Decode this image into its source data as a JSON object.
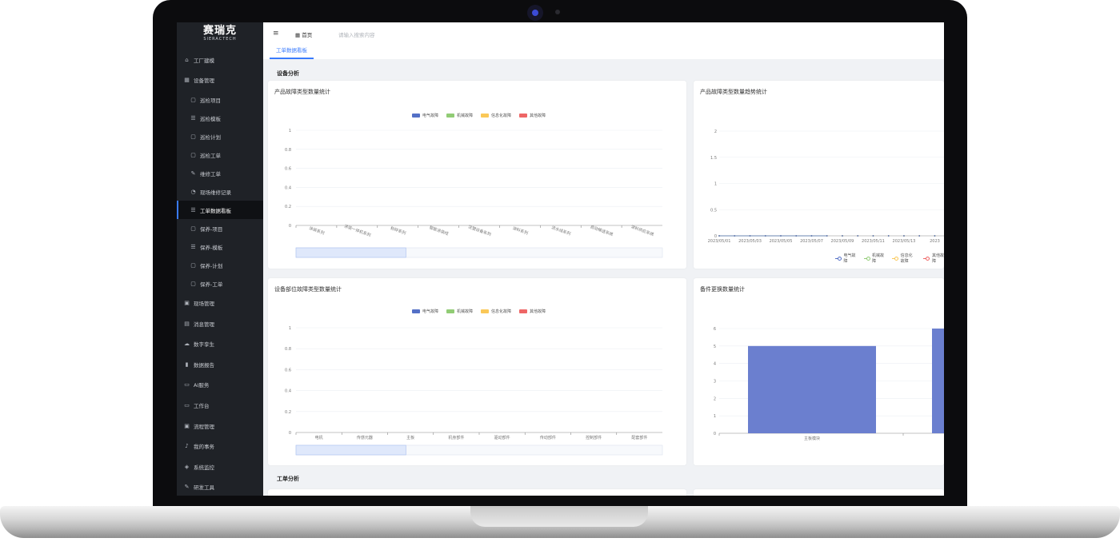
{
  "brand": {
    "name": "赛瑞克",
    "sub": "SIERACTECH"
  },
  "sidebar": {
    "items": [
      {
        "label": "工厂建模",
        "icon": "factory-icon",
        "chev": "⌄",
        "level": "top"
      },
      {
        "label": "设备管理",
        "icon": "equipment-icon",
        "chev": "⌃",
        "level": "top"
      },
      {
        "label": "巡检项目",
        "icon": "doc-icon",
        "chev": "",
        "level": "sub"
      },
      {
        "label": "巡检模板",
        "icon": "list-icon",
        "chev": "",
        "level": "sub"
      },
      {
        "label": "巡检计划",
        "icon": "doc-icon",
        "chev": "",
        "level": "sub"
      },
      {
        "label": "巡检工单",
        "icon": "doc-icon",
        "chev": "",
        "level": "sub"
      },
      {
        "label": "维修工单",
        "icon": "wrench-icon",
        "chev": "",
        "level": "sub"
      },
      {
        "label": "现场维修记录",
        "icon": "record-icon",
        "chev": "",
        "level": "sub"
      },
      {
        "label": "工单数据看板",
        "icon": "list-icon",
        "chev": "",
        "level": "sub",
        "active": true
      },
      {
        "label": "保养-项目",
        "icon": "doc-icon",
        "chev": "",
        "level": "sub"
      },
      {
        "label": "保养-模板",
        "icon": "list-icon",
        "chev": "",
        "level": "sub"
      },
      {
        "label": "保养-计划",
        "icon": "doc-icon",
        "chev": "",
        "level": "sub"
      },
      {
        "label": "保养-工单",
        "icon": "doc-icon",
        "chev": "",
        "level": "sub"
      },
      {
        "label": "现场管理",
        "icon": "site-icon",
        "chev": "⌄",
        "level": "top"
      },
      {
        "label": "消息管理",
        "icon": "message-icon",
        "chev": "⌄",
        "level": "top"
      },
      {
        "label": "数字孪生",
        "icon": "cloud-icon",
        "chev": "",
        "level": "top"
      },
      {
        "label": "数据报告",
        "icon": "bar-chart-icon",
        "chev": "",
        "level": "top"
      },
      {
        "label": "AI服务",
        "icon": "ai-icon",
        "chev": "",
        "level": "top"
      },
      {
        "label": "工作台",
        "icon": "monitor-icon",
        "chev": "⌄",
        "level": "top"
      },
      {
        "label": "流程管理",
        "icon": "flow-icon",
        "chev": "⌄",
        "level": "top"
      },
      {
        "label": "我的事务",
        "icon": "bell-icon",
        "chev": "⌄",
        "level": "top"
      },
      {
        "label": "系统监控",
        "icon": "shield-icon",
        "chev": "⌄",
        "level": "top"
      },
      {
        "label": "研发工具",
        "icon": "tool-icon",
        "chev": "⌄",
        "level": "top"
      }
    ]
  },
  "topbar": {
    "menu_icon": "≡",
    "home_label": "首页",
    "search_placeholder": "请输入搜索内容"
  },
  "tab": {
    "label": "工单数据看板"
  },
  "sections": {
    "device": "设备分析",
    "work": "工单分析"
  },
  "colors": {
    "electric": "#5470c6",
    "mechanical": "#91cc75",
    "informatization": "#fac858",
    "other": "#ee6666"
  },
  "chart_data": [
    {
      "type": "bar",
      "title": "产品故障类型数量统计",
      "legend": [
        "电气故障",
        "机械故障",
        "信息化故障",
        "其他故障"
      ],
      "categories": [
        "涂装系列",
        "涂装一体机系列",
        "粉碎系列",
        "智能涂装线",
        "注塑设备系列",
        "涂料系列",
        "流水线系列",
        "自动输送系统",
        "涂料供应系统"
      ],
      "series": [
        {
          "name": "电气故障",
          "values": [
            0,
            0,
            0,
            0,
            0,
            0,
            0,
            0,
            0
          ]
        },
        {
          "name": "机械故障",
          "values": [
            0,
            0,
            0,
            0,
            0,
            0,
            0,
            0,
            0
          ]
        },
        {
          "name": "信息化故障",
          "values": [
            0,
            0,
            0,
            0,
            0,
            0,
            0,
            0,
            0
          ]
        },
        {
          "name": "其他故障",
          "values": [
            0,
            0,
            0,
            0,
            0,
            0,
            0,
            0,
            0
          ]
        }
      ],
      "yticks": [
        "0",
        "0.2",
        "0.4",
        "0.6",
        "0.8",
        "1"
      ],
      "ylim": [
        0,
        1
      ]
    },
    {
      "type": "line",
      "title": "产品故障类型数量趋势统计",
      "legend": [
        "电气故障",
        "机械故障",
        "信息化故障",
        "其他故障"
      ],
      "x": [
        "2023/05/01",
        "2023/05/03",
        "2023/05/05",
        "2023/05/07",
        "2023/05/09",
        "2023/05/11",
        "2023/05/13",
        "2023"
      ],
      "series": [
        {
          "name": "电气故障",
          "values": [
            0,
            0,
            0,
            0,
            0,
            0,
            0,
            0
          ]
        },
        {
          "name": "机械故障",
          "values": [
            0,
            0,
            0,
            0,
            0,
            0,
            0,
            0
          ]
        },
        {
          "name": "信息化故障",
          "values": [
            0,
            0,
            0,
            0,
            0,
            0,
            0,
            0
          ]
        },
        {
          "name": "其他故障",
          "values": [
            0,
            0,
            0,
            0,
            0,
            0,
            0,
            0
          ]
        }
      ],
      "yticks": [
        "0",
        "0.5",
        "1",
        "1.5",
        "2"
      ],
      "ylim": [
        0,
        2
      ]
    },
    {
      "type": "bar",
      "title": "设备部位故障类型数量统计",
      "legend": [
        "电气故障",
        "机械故障",
        "信息化故障",
        "其他故障"
      ],
      "categories": [
        "电机",
        "传感元器",
        "主板",
        "机身部件",
        "驱动部件",
        "传动部件",
        "控制部件",
        "配套部件"
      ],
      "series": [
        {
          "name": "电气故障",
          "values": [
            0,
            0,
            0,
            0,
            0,
            0,
            0,
            0
          ]
        },
        {
          "name": "机械故障",
          "values": [
            0,
            0,
            0,
            0,
            0,
            0,
            0,
            0
          ]
        },
        {
          "name": "信息化故障",
          "values": [
            0,
            0,
            0,
            0,
            0,
            0,
            0,
            0
          ]
        },
        {
          "name": "其他故障",
          "values": [
            0,
            0,
            0,
            0,
            0,
            0,
            0,
            0
          ]
        }
      ],
      "yticks": [
        "0",
        "0.2",
        "0.4",
        "0.6",
        "0.8",
        "1"
      ],
      "ylim": [
        0,
        1
      ]
    },
    {
      "type": "bar",
      "title": "备件更换数量统计",
      "categories": [
        "主板模块",
        ""
      ],
      "values": [
        5,
        6
      ],
      "yticks": [
        "0",
        "1",
        "2",
        "3",
        "4",
        "5",
        "6"
      ],
      "ylim": [
        0,
        6
      ]
    }
  ]
}
